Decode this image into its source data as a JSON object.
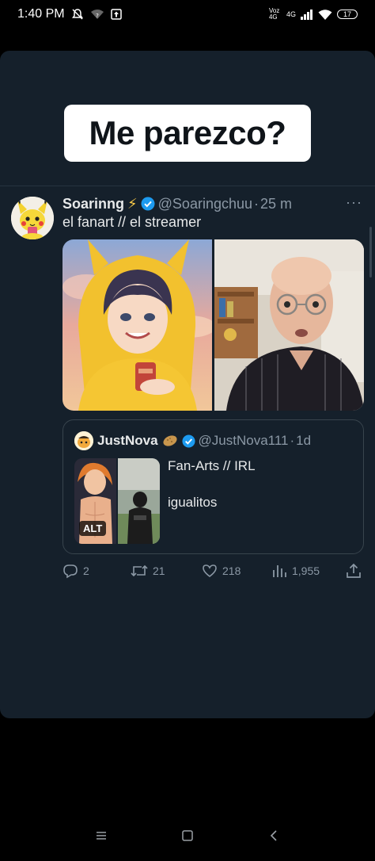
{
  "status_bar": {
    "time": "1:40 PM",
    "network_label": "Voz 4G",
    "network_gen": "4G",
    "battery": "17",
    "icons": [
      "mute-bell-icon",
      "wifi-question-icon",
      "upload-icon",
      "signal-icon",
      "wifi-icon",
      "battery-icon"
    ]
  },
  "caption": {
    "text": "Me parezco?"
  },
  "tweet": {
    "display_name": "Soarinng",
    "bolt": "⚡",
    "handle": "@Soaringchuu",
    "separator": "·",
    "time": "25 m",
    "text": "el fanart // el streamer",
    "more": "···"
  },
  "quote": {
    "display_name": "JustNova",
    "handle": "@JustNova111",
    "separator": "·",
    "time": "1d",
    "text_line1": "Fan-Arts // IRL",
    "text_line2": "igualitos",
    "alt_badge": "ALT"
  },
  "actions": {
    "replies": "2",
    "retweets": "21",
    "likes": "218",
    "views": "1,955"
  },
  "colors": {
    "background": "#15202b",
    "verified": "#1d9bf0",
    "muted_text": "#8b98a5"
  }
}
